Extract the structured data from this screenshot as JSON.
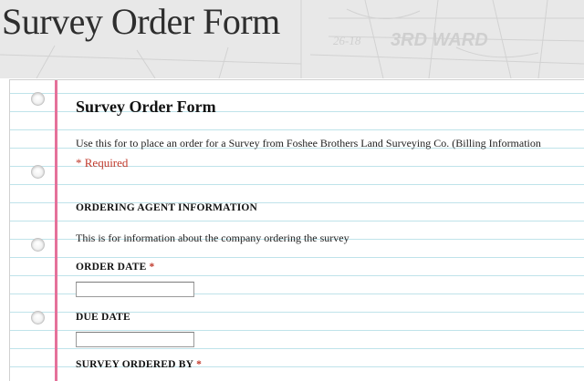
{
  "page": {
    "title": "Survey Order Form"
  },
  "header_map": {
    "labels": [
      "26-18",
      "3RD WARD"
    ]
  },
  "form": {
    "title": "Survey Order Form",
    "description": "Use this for to place an order for a Survey from Foshee Brothers Land Surveying Co. (Billing Information",
    "required_note": "* Required"
  },
  "section": {
    "heading": "ORDERING AGENT INFORMATION",
    "description": "This is for information about the company ordering the survey"
  },
  "fields": {
    "order_date": {
      "label": "ORDER DATE",
      "required_marker": "*",
      "value": ""
    },
    "due_date": {
      "label": "DUE DATE",
      "value": ""
    },
    "survey_ordered_by": {
      "label": "SURVEY ORDERED BY",
      "required_marker": "*"
    }
  },
  "colors": {
    "margin_line": "#e5719a",
    "ruled_line": "#bfe3ea",
    "required": "#c0392b",
    "header_band": "#e8e8e8"
  },
  "icons": {
    "binder_hole": "binder-hole-icon"
  }
}
